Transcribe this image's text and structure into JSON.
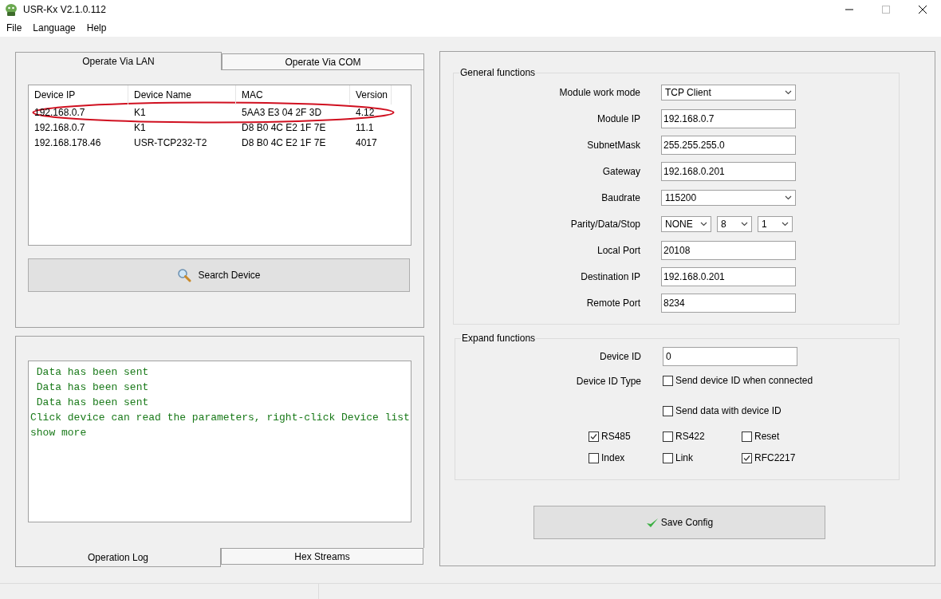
{
  "window": {
    "title": "USR-Kx V2.1.0.112"
  },
  "menu": [
    "File",
    "Language",
    "Help"
  ],
  "device_tabs": [
    {
      "label": "Operate Via LAN",
      "selected": true
    },
    {
      "label": "Operate Via COM",
      "selected": false
    }
  ],
  "device_table": {
    "columns": [
      "Device IP",
      "Device Name",
      "MAC",
      "Version"
    ],
    "rows": [
      [
        "192.168.0.7",
        "K1",
        "5AA3 E3 04 2F 3D",
        "4.12"
      ],
      [
        "192.168.0.7",
        "K1",
        "D8 B0 4C E2 1F 7E",
        "11.1"
      ],
      [
        "192.168.178.46",
        "USR-TCP232-T2",
        "D8 B0 4C E2 1F 7E",
        "4017"
      ]
    ]
  },
  "search_button": "Search Device",
  "log": {
    "lines": [
      " Data has been sent",
      " Data has been sent",
      " Data has been sent",
      "Click device can read the parameters, right-click Device list show more"
    ]
  },
  "log_tabs": [
    {
      "label": "Operation Log",
      "selected": true
    },
    {
      "label": "Hex Streams",
      "selected": false
    }
  ],
  "general": {
    "title": "General functions",
    "fields": [
      {
        "kind": "select",
        "label": "Module work mode",
        "value": "TCP Client"
      },
      {
        "kind": "text",
        "label": "Module IP",
        "value": "192.168.0.7"
      },
      {
        "kind": "text",
        "label": "SubnetMask",
        "value": "255.255.255.0"
      },
      {
        "kind": "text",
        "label": "Gateway",
        "value": "192.168.0.201"
      },
      {
        "kind": "select",
        "label": "Baudrate",
        "value": "115200"
      },
      {
        "kind": "triple",
        "label": "Parity/Data/Stop",
        "values": [
          "NONE",
          "8",
          "1"
        ]
      },
      {
        "kind": "text",
        "label": "Local Port",
        "value": "20108"
      },
      {
        "kind": "text",
        "label": "Destination IP",
        "value": "192.168.0.201"
      },
      {
        "kind": "text",
        "label": "Remote Port",
        "value": "8234"
      }
    ]
  },
  "expand": {
    "title": "Expand functions",
    "device_id": {
      "label": "Device ID",
      "value": "0"
    },
    "id_type_label": "Device ID Type",
    "id_options": [
      {
        "label": "Send device ID when connected",
        "checked": false
      },
      {
        "label": "Send data with device ID",
        "checked": false
      }
    ],
    "options": [
      {
        "label": "RS485",
        "checked": true
      },
      {
        "label": "RS422",
        "checked": false
      },
      {
        "label": "Reset",
        "checked": false
      },
      {
        "label": "Index",
        "checked": false
      },
      {
        "label": "Link",
        "checked": false
      },
      {
        "label": "RFC2217",
        "checked": true
      }
    ]
  },
  "save_button": "Save Config"
}
